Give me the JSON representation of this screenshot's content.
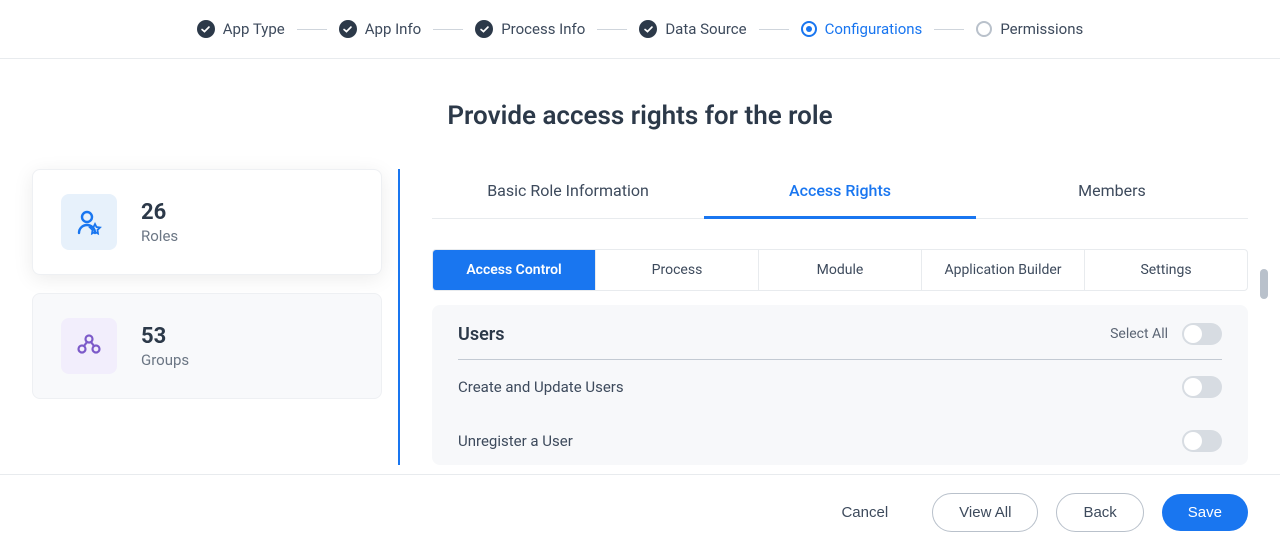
{
  "stepper": {
    "steps": [
      {
        "label": "App Type",
        "state": "completed"
      },
      {
        "label": "App Info",
        "state": "completed"
      },
      {
        "label": "Process Info",
        "state": "completed"
      },
      {
        "label": "Data Source",
        "state": "completed"
      },
      {
        "label": "Configurations",
        "state": "active"
      },
      {
        "label": "Permissions",
        "state": "pending"
      }
    ]
  },
  "title": "Provide access rights for the role",
  "sidebar": {
    "roles": {
      "count": "26",
      "label": "Roles"
    },
    "groups": {
      "count": "53",
      "label": "Groups"
    }
  },
  "tabs": [
    {
      "label": "Basic Role Information",
      "active": false
    },
    {
      "label": "Access Rights",
      "active": true
    },
    {
      "label": "Members",
      "active": false
    }
  ],
  "subtabs": [
    {
      "label": "Access Control",
      "active": true
    },
    {
      "label": "Process",
      "active": false
    },
    {
      "label": "Module",
      "active": false
    },
    {
      "label": "Application Builder",
      "active": false
    },
    {
      "label": "Settings",
      "active": false
    }
  ],
  "panel": {
    "section_title": "Users",
    "select_all_label": "Select All",
    "permissions": [
      "Create and Update Users",
      "Unregister a User"
    ]
  },
  "footer": {
    "cancel": "Cancel",
    "view_all": "View All",
    "back": "Back",
    "save": "Save"
  }
}
